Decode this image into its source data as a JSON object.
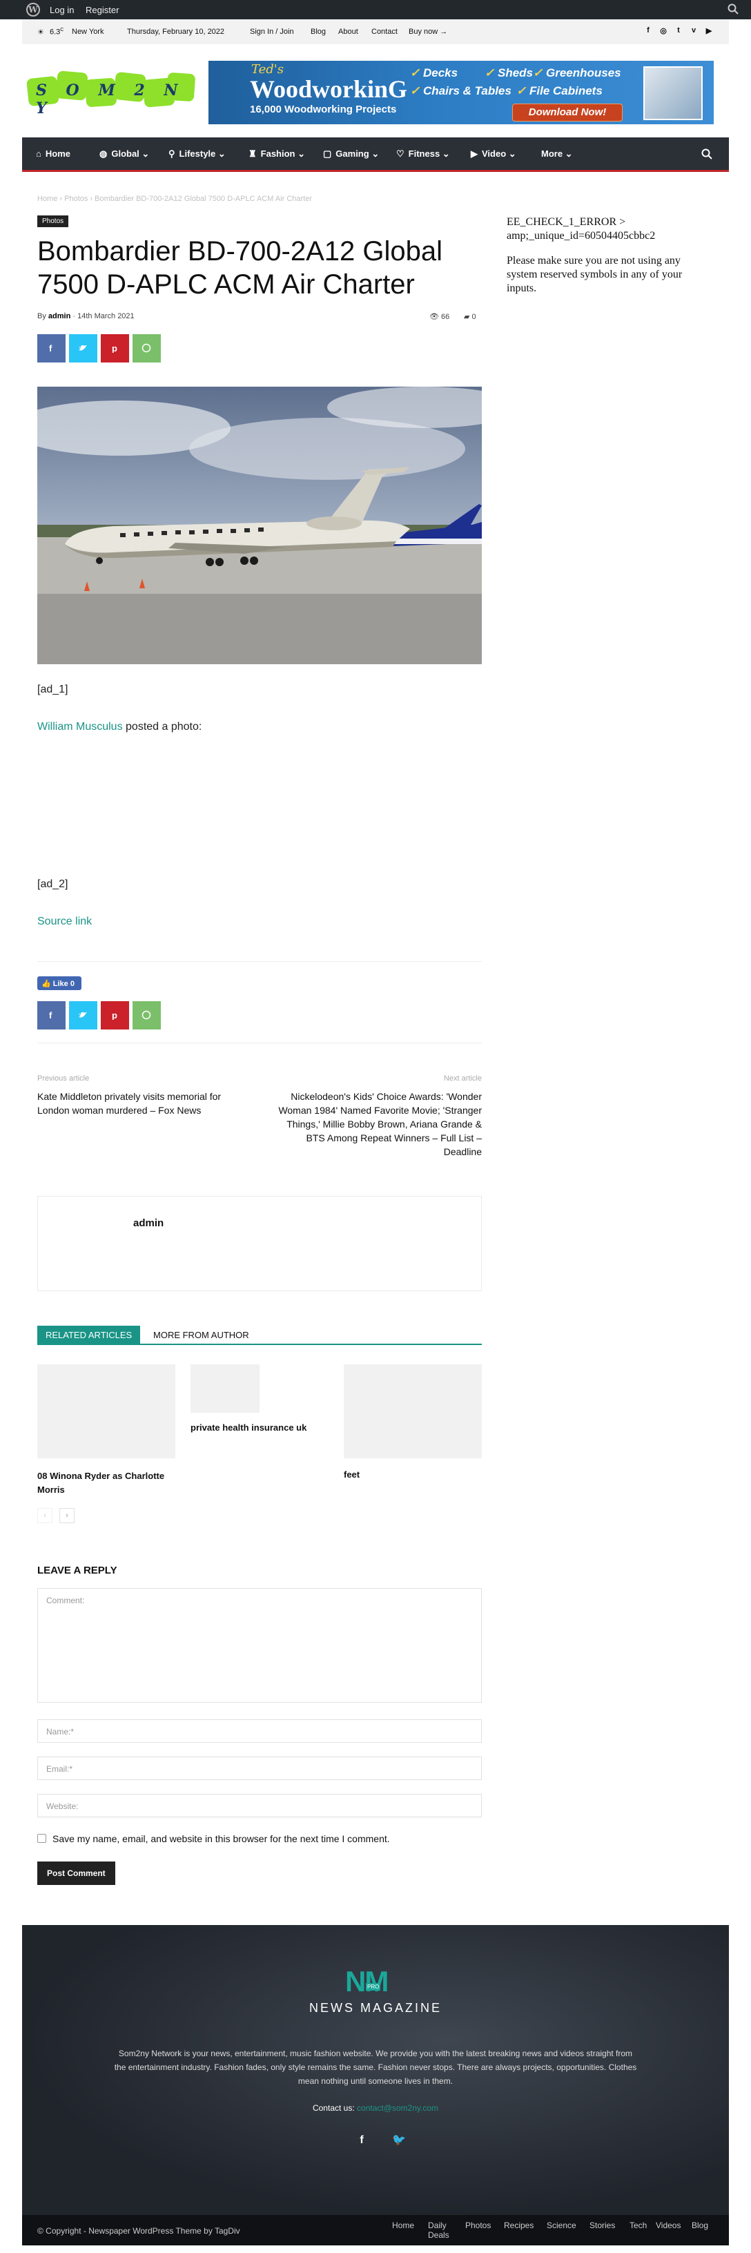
{
  "adminbar": {
    "login": "Log in",
    "register": "Register"
  },
  "topbar": {
    "temp": "6.3",
    "unit": "C",
    "city": "New York",
    "date": "Thursday, February 10, 2022",
    "links": [
      "Sign In / Join",
      "Blog",
      "About",
      "Contact",
      "Buy now"
    ]
  },
  "logo": {
    "text": "S O M 2 N Y"
  },
  "banner": {
    "brand": "Ted's",
    "title": "WoodworkinG",
    "subtitle": "16,000 Woodworking Projects",
    "items": [
      "Decks",
      "Sheds",
      "Greenhouses",
      "Chairs & Tables",
      "File Cabinets"
    ],
    "cta": "Download Now!"
  },
  "nav": {
    "items": [
      "Home",
      "Global",
      "Lifestyle",
      "Fashion",
      "Gaming",
      "Fitness",
      "Video",
      "More"
    ]
  },
  "breadcrumb": [
    "Home",
    "Photos",
    "Bombardier BD-700-2A12 Global 7500 D-APLC ACM Air Charter"
  ],
  "post": {
    "category": "Photos",
    "title": "Bombardier BD-700-2A12 Global 7500 D-APLC ACM Air Charter",
    "by": "By",
    "author": "admin",
    "date": "14th March 2021",
    "views": "66",
    "comments": "0",
    "ad1": "[ad_1]",
    "poster": "William Musculus",
    "posted": "posted a photo:",
    "ad2": "[ad_2]",
    "source": "Source link",
    "like": "Like 0"
  },
  "sidebar": {
    "error": "EE_CHECK_1_ERROR > amp;_unique_id=60504405cbbc2",
    "message": "Please make sure you are not using any system reserved symbols in any of your inputs."
  },
  "postnav": {
    "prev_label": "Previous article",
    "prev_title": "Kate Middleton privately visits memorial for London woman murdered – Fox News",
    "next_label": "Next article",
    "next_title": "Nickelodeon's Kids' Choice Awards: 'Wonder Woman 1984' Named Favorite Movie; 'Stranger Things,' Millie Bobby Brown, Ariana Grande & BTS Among Repeat Winners – Full List – Deadline"
  },
  "authorbox": {
    "name": "admin"
  },
  "related": {
    "tab_active": "RELATED ARTICLES",
    "tab_other": "MORE FROM AUTHOR",
    "items": [
      "08 Winona Ryder as Charlotte Morris",
      "private health insurance uk",
      "feet"
    ]
  },
  "reply": {
    "heading": "LEAVE A REPLY",
    "comment_ph": "Comment:",
    "name_ph": "Name:*",
    "email_ph": "Email:*",
    "website_ph": "Website:",
    "save_label": "Save my name, email, and website in this browser for the next time I comment.",
    "submit": "Post Comment"
  },
  "footer": {
    "brand_logo": "NM",
    "brand_tag": "PRO",
    "brand": "NEWS MAGAZINE",
    "about": "Som2ny Network is your news, entertainment, music fashion website. We provide you with the latest breaking news and videos straight from the entertainment industry. Fashion fades, only style remains the same. Fashion never stops. There are always projects, opportunities. Clothes mean nothing until someone lives in them.",
    "contact_label": "Contact us:",
    "contact_email": "contact@som2ny.com",
    "copyright": "© Copyright - Newspaper WordPress Theme by TagDiv",
    "links": [
      "Home",
      "Daily Deals",
      "Photos",
      "Recipes",
      "Science",
      "Stories",
      "Tech",
      "Videos",
      "Blog"
    ]
  },
  "colors": {
    "accent": "#1a9487",
    "nav_bg": "#2b2f36",
    "nav_border": "#c0262a",
    "logo_green": "#8ee02b"
  }
}
